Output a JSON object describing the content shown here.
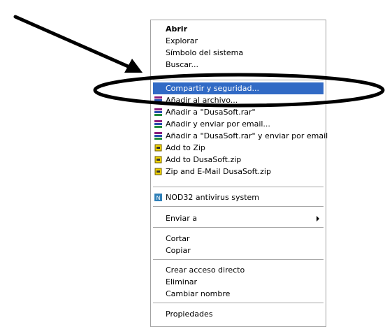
{
  "context_menu": {
    "open": "Abrir",
    "explore": "Explorar",
    "command_prompt": "Símbolo del sistema",
    "search": "Buscar...",
    "sharing_security": "Compartir y seguridad...",
    "add_to_archive": "Añadir al archivo...",
    "add_to_rar": "Añadir a \"DusaSoft.rar\"",
    "add_and_email": "Añadir y enviar por email...",
    "add_to_rar_and_email": "Añadir a \"DusaSoft.rar\" y enviar por email",
    "add_to_zip": "Add to Zip",
    "add_to_named_zip": "Add to DusaSoft.zip",
    "zip_and_email": "Zip and E-Mail DusaSoft.zip",
    "antivirus": "NOD32 antivirus system",
    "send_to": "Enviar a",
    "cut": "Cortar",
    "copy": "Copiar",
    "create_shortcut": "Crear acceso directo",
    "delete": "Eliminar",
    "rename": "Cambiar nombre",
    "properties": "Propiedades"
  },
  "icons": {
    "winrar": "winrar-books-icon",
    "winzip": "winzip-vise-icon",
    "nod32": "nod32-icon",
    "submenu": "submenu-arrow-icon"
  },
  "colors": {
    "selection": "#316ac5",
    "annotation": "#000000"
  }
}
